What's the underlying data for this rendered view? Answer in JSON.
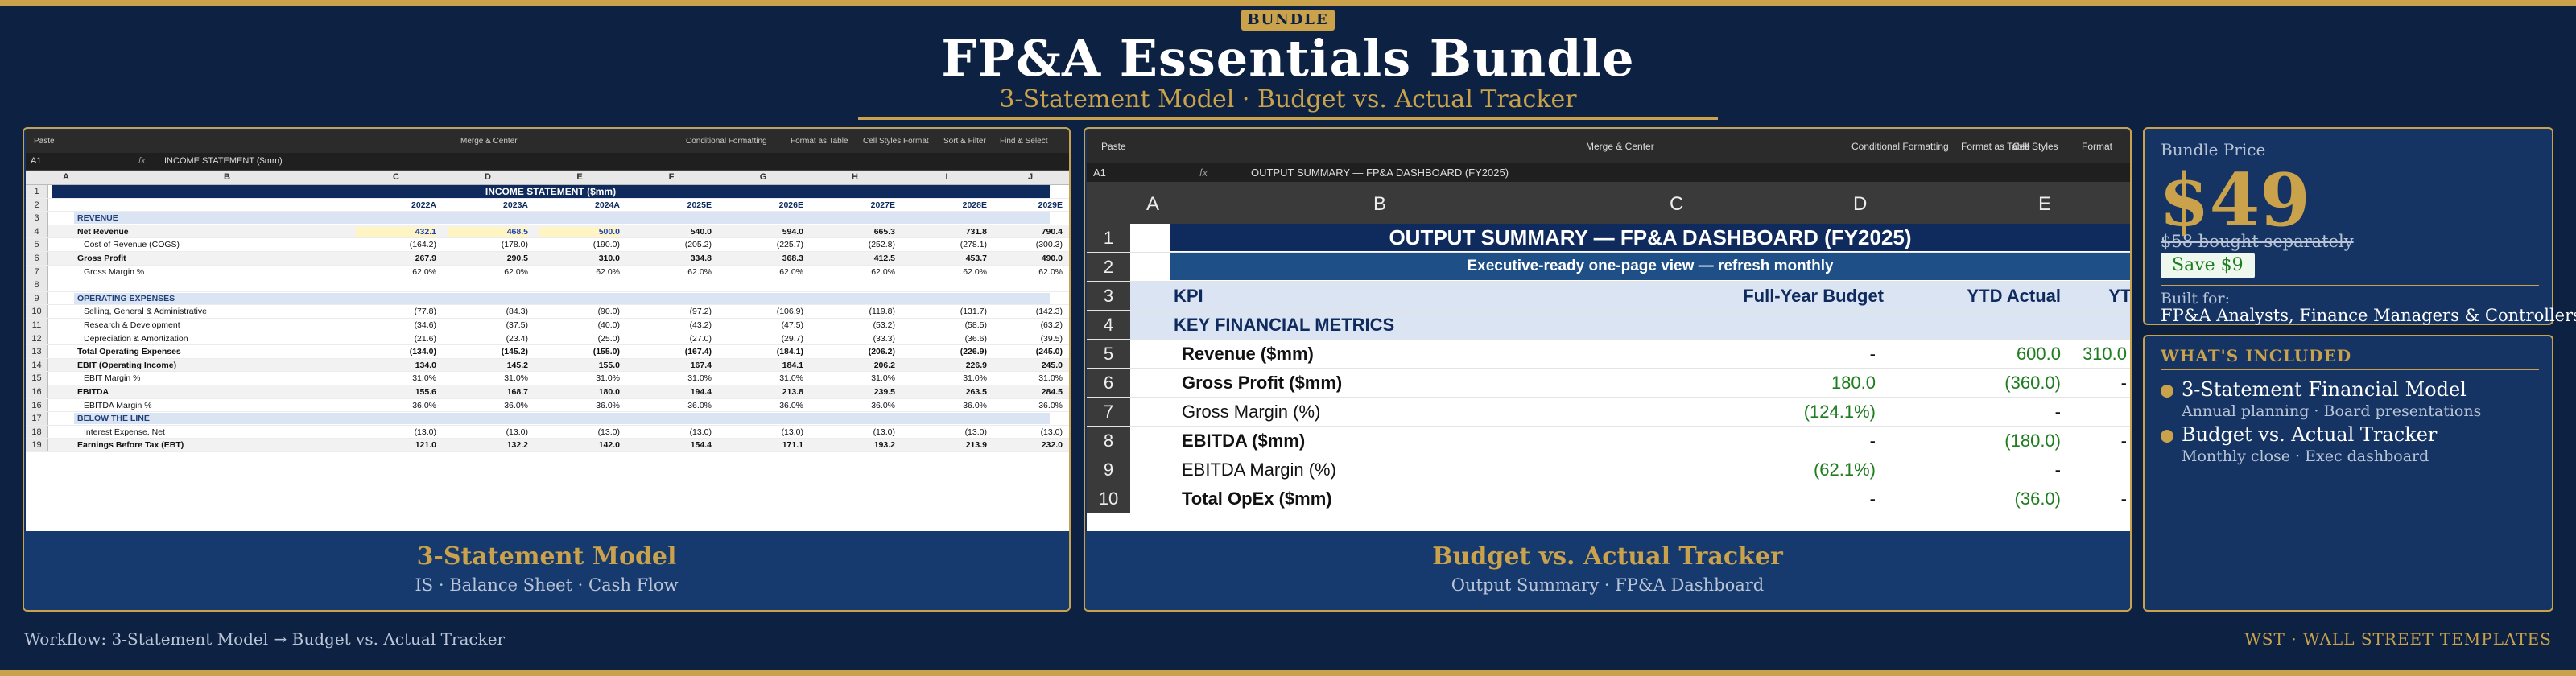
{
  "header": {
    "badge": "BUNDLE",
    "title": "FP&A Essentials Bundle",
    "subtitle": "3-Statement Model  ·  Budget vs. Actual Tracker"
  },
  "panel_left": {
    "caption_title": "3-Statement Model",
    "caption_sub": "IS · Balance Sheet · Cash Flow",
    "ribbon": [
      "Paste",
      "Merge & Center",
      "Conditional Formatting",
      "Format as Table",
      "Cell Styles",
      "Format",
      "Sort & Filter",
      "Find & Select"
    ],
    "cell_ref": "A1",
    "fx": "fx",
    "formula": "INCOME STATEMENT ($mm)",
    "columns": [
      "A",
      "B",
      "C",
      "D",
      "E",
      "F",
      "G",
      "H",
      "I",
      "J"
    ],
    "sheet_title": "INCOME STATEMENT ($mm)",
    "years": [
      "2022A",
      "2023A",
      "2024A",
      "2025E",
      "2026E",
      "2027E",
      "2028E",
      "2029E"
    ],
    "rows": [
      {
        "n": "3",
        "label": "REVENUE",
        "type": "section",
        "values": []
      },
      {
        "n": "4",
        "label": "Net Revenue",
        "type": "bold",
        "values": [
          "432.1",
          "468.5",
          "500.0",
          "540.0",
          "594.0",
          "665.3",
          "731.8",
          "790.4"
        ]
      },
      {
        "n": "5",
        "label": "Cost of Revenue (COGS)",
        "type": "ital",
        "values": [
          "(164.2)",
          "(178.0)",
          "(190.0)",
          "(205.2)",
          "(225.7)",
          "(252.8)",
          "(278.1)",
          "(300.3)"
        ]
      },
      {
        "n": "6",
        "label": "Gross Profit",
        "type": "bold",
        "values": [
          "267.9",
          "290.5",
          "310.0",
          "334.8",
          "368.3",
          "412.5",
          "453.7",
          "490.0"
        ]
      },
      {
        "n": "7",
        "label": "Gross Margin %",
        "type": "ital",
        "values": [
          "62.0%",
          "62.0%",
          "62.0%",
          "62.0%",
          "62.0%",
          "62.0%",
          "62.0%",
          "62.0%"
        ]
      },
      {
        "n": "8",
        "label": "",
        "type": "blank",
        "values": []
      },
      {
        "n": "9",
        "label": "OPERATING EXPENSES",
        "type": "section",
        "values": []
      },
      {
        "n": "10",
        "label": "Selling, General & Administrative",
        "type": "ital",
        "values": [
          "(77.8)",
          "(84.3)",
          "(90.0)",
          "(97.2)",
          "(106.9)",
          "(119.8)",
          "(131.7)",
          "(142.3)"
        ]
      },
      {
        "n": "11",
        "label": "Research & Development",
        "type": "ital",
        "values": [
          "(34.6)",
          "(37.5)",
          "(40.0)",
          "(43.2)",
          "(47.5)",
          "(53.2)",
          "(58.5)",
          "(63.2)"
        ]
      },
      {
        "n": "12",
        "label": "Depreciation & Amortization",
        "type": "ital",
        "values": [
          "(21.6)",
          "(23.4)",
          "(25.0)",
          "(27.0)",
          "(29.7)",
          "(33.3)",
          "(36.6)",
          "(39.5)"
        ]
      },
      {
        "n": "13",
        "label": "Total Operating Expenses",
        "type": "bold",
        "values": [
          "(134.0)",
          "(145.2)",
          "(155.0)",
          "(167.4)",
          "(184.1)",
          "(206.2)",
          "(226.9)",
          "(245.0)"
        ]
      },
      {
        "n": "14",
        "label": "EBIT (Operating Income)",
        "type": "bold",
        "values": [
          "134.0",
          "145.2",
          "155.0",
          "167.4",
          "184.1",
          "206.2",
          "226.9",
          "245.0"
        ]
      },
      {
        "n": "15",
        "label": "EBIT Margin %",
        "type": "ital",
        "values": [
          "31.0%",
          "31.0%",
          "31.0%",
          "31.0%",
          "31.0%",
          "31.0%",
          "31.0%",
          "31.0%"
        ]
      },
      {
        "n": "16",
        "label": "EBITDA",
        "type": "bold",
        "values": [
          "155.6",
          "168.7",
          "180.0",
          "194.4",
          "213.8",
          "239.5",
          "263.5",
          "284.5"
        ]
      },
      {
        "n": "16",
        "label": "EBITDA Margin %",
        "type": "ital",
        "values": [
          "36.0%",
          "36.0%",
          "36.0%",
          "36.0%",
          "36.0%",
          "36.0%",
          "36.0%",
          "36.0%"
        ]
      },
      {
        "n": "17",
        "label": "BELOW THE LINE",
        "type": "section",
        "values": []
      },
      {
        "n": "18",
        "label": "Interest Expense, Net",
        "type": "ital",
        "values": [
          "(13.0)",
          "(13.0)",
          "(13.0)",
          "(13.0)",
          "(13.0)",
          "(13.0)",
          "(13.0)",
          "(13.0)"
        ]
      },
      {
        "n": "19",
        "label": "Earnings Before Tax (EBT)",
        "type": "bold",
        "values": [
          "121.0",
          "132.2",
          "142.0",
          "154.4",
          "171.1",
          "193.2",
          "213.9",
          "232.0"
        ]
      }
    ]
  },
  "panel_mid": {
    "caption_title": "Budget vs. Actual Tracker",
    "caption_sub": "Output Summary · FP&A Dashboard",
    "ribbon": [
      "Paste",
      "Merge & Center",
      "Conditional Formatting",
      "Format as Table",
      "Cell Styles",
      "Format"
    ],
    "cell_ref": "A1",
    "fx": "fx",
    "formula": "OUTPUT SUMMARY — FP&A DASHBOARD (FY2025)",
    "columns": [
      "A",
      "B",
      "C",
      "D",
      "E"
    ],
    "title": "OUTPUT SUMMARY — FP&A DASHBOARD (FY2025)",
    "subtitle": "Executive-ready one-page view — refresh monthly",
    "kpi_headers": [
      "KPI",
      "Full-Year Budget",
      "YTD Actual",
      "YTD Variance"
    ],
    "section": "KEY FINANCIAL METRICS",
    "rows": [
      {
        "n": "5",
        "label": "Revenue ($mm)",
        "b": true,
        "budget": "-",
        "actual": "600.0",
        "variance": "310.0"
      },
      {
        "n": "6",
        "label": "Gross Profit ($mm)",
        "b": true,
        "budget": "180.0",
        "actual": "(360.0)",
        "variance": "-"
      },
      {
        "n": "7",
        "label": "Gross Margin (%)",
        "b": false,
        "budget": "(124.1%)",
        "actual": "-",
        "variance": ""
      },
      {
        "n": "8",
        "label": "EBITDA ($mm)",
        "b": true,
        "budget": "-",
        "actual": "(180.0)",
        "variance": "-"
      },
      {
        "n": "9",
        "label": "EBITDA Margin (%)",
        "b": false,
        "budget": "(62.1%)",
        "actual": "-",
        "variance": ""
      },
      {
        "n": "10",
        "label": "Total OpEx ($mm)",
        "b": true,
        "budget": "-",
        "actual": "(36.0)",
        "variance": "-"
      }
    ]
  },
  "price": {
    "label": "Bundle Price",
    "amount": "$49",
    "strike": "$58 bought separately",
    "save": "Save $9",
    "built_for_label": "Built for:",
    "audience": "FP&A Analysts, Finance Managers & Controllers"
  },
  "included": {
    "heading": "WHAT'S INCLUDED",
    "items": [
      {
        "name": "3-Statement Financial Model",
        "desc": "Annual planning · Board presentations"
      },
      {
        "name": "Budget vs. Actual Tracker",
        "desc": "Monthly close · Exec dashboard"
      }
    ]
  },
  "footer": {
    "workflow": "Workflow: 3-Statement Model → Budget vs. Actual Tracker",
    "brand": "WST · WALL STREET TEMPLATES"
  },
  "colors": {
    "navy": "#0d2142",
    "gold": "#c9a24b",
    "panel": "#153463"
  }
}
